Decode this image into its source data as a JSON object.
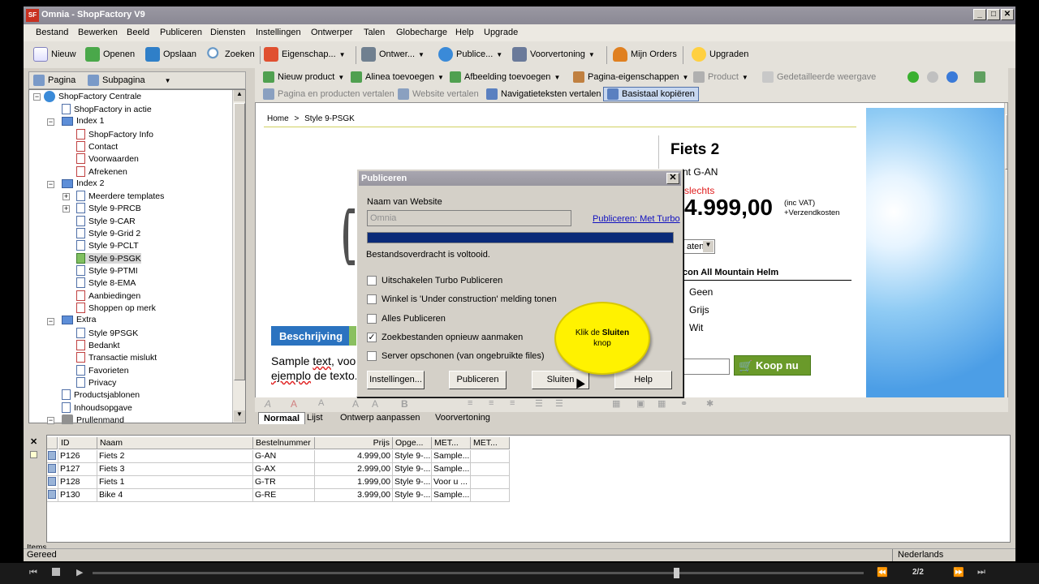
{
  "window": {
    "title": "Omnia - ShopFactory V9",
    "logo": "SF"
  },
  "menu": [
    "Bestand",
    "Bewerken",
    "Beeld",
    "Publiceren",
    "Diensten",
    "Instellingen",
    "Ontwerper",
    "Talen",
    "Globecharge",
    "Help",
    "Upgrade"
  ],
  "toolbar1": {
    "nieuw": "Nieuw",
    "openen": "Openen",
    "opslaan": "Opslaan",
    "zoeken": "Zoeken",
    "eigenschap": "Eigenschap...",
    "ontwerp": "Ontwer...",
    "publiceer": "Publice...",
    "voorvertoning": "Voorvertoning",
    "orders": "Mijn Orders",
    "upgraden": "Upgraden"
  },
  "paneltabs": {
    "pagina": "Pagina",
    "subpagina": "Subpagina"
  },
  "toolbar2": {
    "nieuw_product": "Nieuw product",
    "alinea": "Alinea toevoegen",
    "afbeelding": "Afbeelding toevoegen",
    "pagina_eig": "Pagina-eigenschappen",
    "product": "Product",
    "detail": "Gedetailleerde weergave"
  },
  "toolbar3": {
    "vertalen": "Pagina en producten vertalen",
    "website": "Website vertalen",
    "navigatie": "Navigatieteksten vertalen",
    "basistaal": "Basistaal kopiëren"
  },
  "tree": {
    "root": "ShopFactory Centrale",
    "actie": "ShopFactory in actie",
    "index1": "Index 1",
    "i1": [
      "ShopFactory Info",
      "Contact",
      "Voorwaarden",
      "Afrekenen"
    ],
    "index2": "Index 2",
    "i2": [
      "Meerdere templates",
      "Style 9-PRCB",
      "Style 9-CAR",
      "Style 9-Grid 2",
      "Style 9-PCLT",
      "Style 9-PSGK",
      "Style 9-PTMI",
      "Style 8-EMA",
      "Aanbiedingen",
      "Shoppen op merk"
    ],
    "extra": "Extra",
    "ex": [
      "Style 9PSGK",
      "Bedankt",
      "Transactie mislukt",
      "Favorieten",
      "Privacy"
    ],
    "productsjablonen": "Productsjablonen",
    "inhoud": "Inhoudsopgave",
    "prullenmand": "Prullenmand"
  },
  "page": {
    "breadcrumb_home": "Home",
    "breadcrumb_sep": ">",
    "breadcrumb_page": "Style 9-PSGK",
    "product_title": "Fiets 2",
    "code_label": "nt",
    "code": "G-AN",
    "price_label": "slechts",
    "price": "4.999,00",
    "vat": "(inc VAT)",
    "shipping": "+Verzendkosten",
    "select_partial": "aten",
    "helm": "con All Mountain Helm",
    "options": [
      "Geen",
      "Grijs",
      "Wit"
    ],
    "buy": "Koop nu",
    "tab_beschrijving": "Beschrijving",
    "sample1": "Sample",
    "sample1b": "text",
    "sample1c": ", voor",
    "sample2": "ejemplo",
    "sample2b": " de texto."
  },
  "viewtabs": [
    "Normaal",
    "Lijst",
    "Ontwerp aanpassen",
    "Voorvertoning"
  ],
  "dialog": {
    "title": "Publiceren",
    "site_label": "Naam van Website",
    "site_value": "Omnia",
    "turbo_link": "Publiceren: Met Turbo",
    "progress": 1.0,
    "status": "Bestandsoverdracht is voltooid.",
    "checks": [
      {
        "label": "Uitschakelen Turbo Publiceren",
        "checked": false
      },
      {
        "label": "Winkel is 'Under construction' melding tonen",
        "checked": false
      },
      {
        "label": "Alles Publiceren",
        "checked": false
      },
      {
        "label": "Zoekbestanden opnieuw aanmaken",
        "checked": true
      },
      {
        "label": "Server opschonen (van ongebruikte files)",
        "checked": false
      }
    ],
    "btn_instellingen": "Instellingen...",
    "btn_publiceren": "Publiceren",
    "btn_sluiten": "Sluiten",
    "btn_help": "Help"
  },
  "bubble": {
    "pre": "Klik de",
    "bold": "Sluiten",
    "post": "knop"
  },
  "grid": {
    "headers": [
      "ID",
      "Naam",
      "Bestelnummer",
      "Prijs",
      "Opge...",
      "MET...",
      "MET..."
    ],
    "rows": [
      [
        "P126",
        "Fiets 2",
        "G-AN",
        "4.999,00",
        "Style 9-...",
        "Sample..."
      ],
      [
        "P127",
        "Fiets 3",
        "G-AX",
        "2.999,00",
        "Style 9-...",
        "Sample..."
      ],
      [
        "P128",
        "Fiets 1",
        "G-TR",
        "1.999,00",
        "Style 9-...",
        "Voor u ..."
      ],
      [
        "P130",
        "Bike 4",
        "G-RE",
        "3.999,00",
        "Style 9-...",
        "Sample..."
      ]
    ],
    "items_label": "Items"
  },
  "status": {
    "left": "Gereed",
    "lang": "Nederlands"
  },
  "player": {
    "counter": "2/2"
  }
}
